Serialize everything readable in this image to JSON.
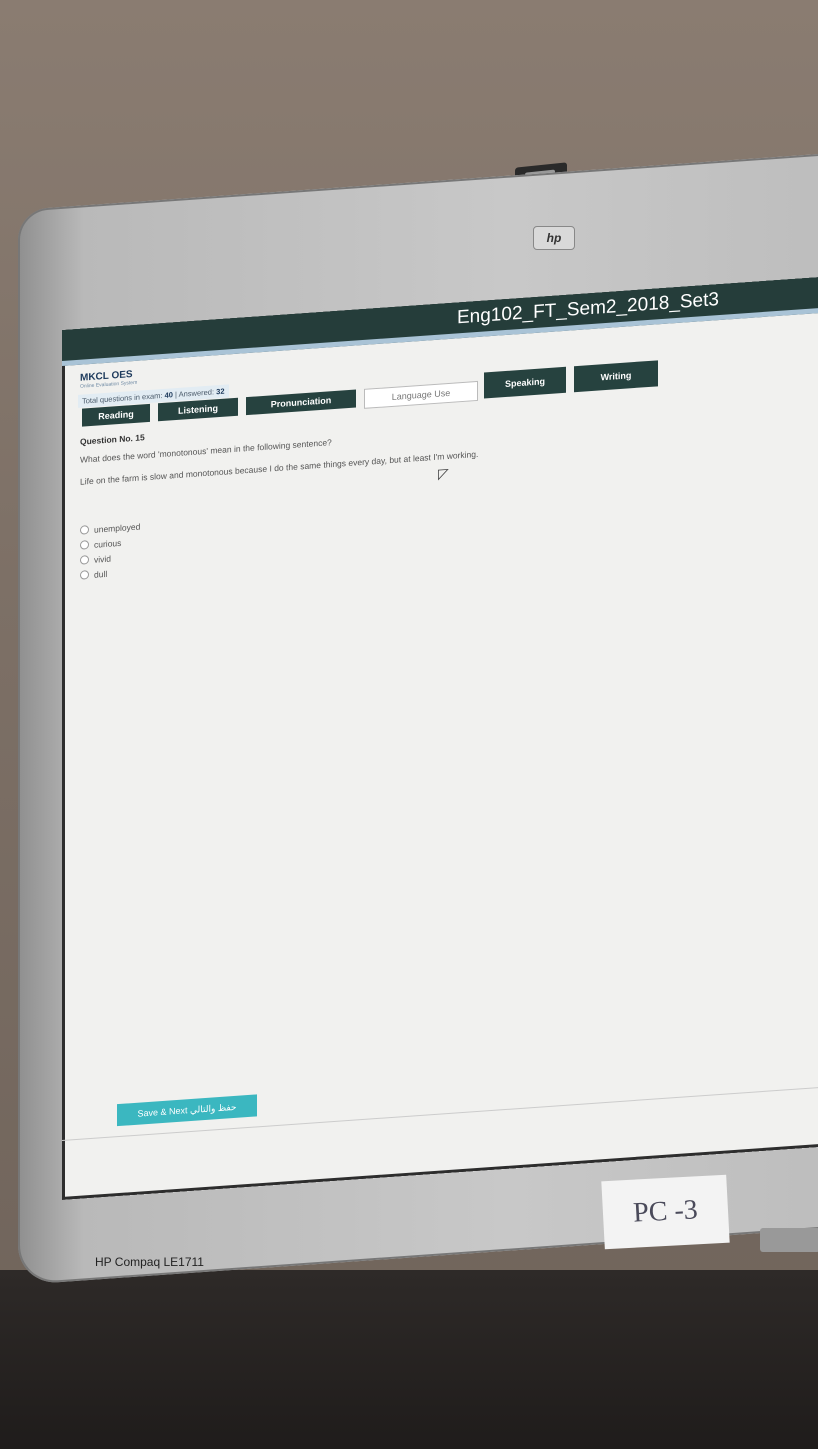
{
  "window": {
    "title": "Eng102_FT_Sem2_2018_Set3"
  },
  "brand": {
    "name": "MKCL OES",
    "tagline": "Online Evaluation System"
  },
  "stats": {
    "total_label": "Total questions in exam:",
    "total_value": "40",
    "answered_label": "| Answered:",
    "answered_value": "32"
  },
  "tabs": [
    {
      "label": "Reading"
    },
    {
      "label": "Listening"
    },
    {
      "label": "Pronunciation"
    },
    {
      "label": "Language Use"
    },
    {
      "label": "Speaking"
    },
    {
      "label": "Writing"
    }
  ],
  "question": {
    "number": "Question No. 15",
    "prompt": "What does the word 'monotonous' mean in the following sentence?",
    "sentence": "Life on the farm is slow and monotonous because I do the same things every day, but at least I'm working.",
    "options": [
      "unemployed",
      "curious",
      "vivid",
      "dull"
    ]
  },
  "save_button": {
    "label": "Save & Next حفظ والتالي"
  },
  "monitor": {
    "brand_logo": "hp",
    "model": "HP Compaq LE1711"
  },
  "sticker": {
    "label": "PC -3"
  },
  "colors": {
    "titlebar": "#253d3a",
    "tab": "#26423f",
    "save": "#3bb7c0"
  }
}
